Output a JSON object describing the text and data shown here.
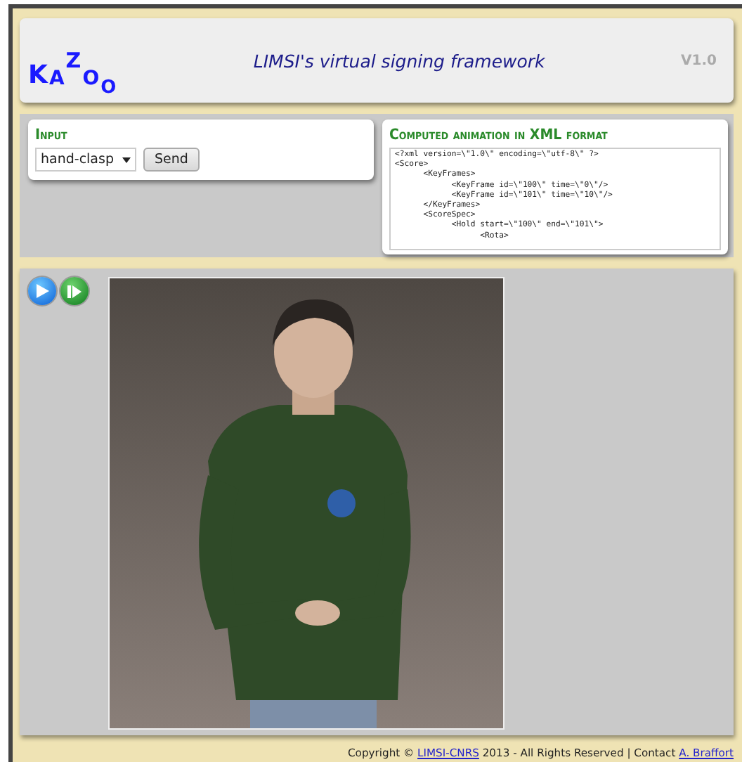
{
  "header": {
    "logo": [
      {
        "letter": "K",
        "kind": "base"
      },
      {
        "letter": "A",
        "kind": "small"
      },
      {
        "letter": "Z",
        "kind": "raised"
      },
      {
        "letter": "O",
        "kind": "small"
      },
      {
        "letter": "O",
        "kind": "lowered"
      }
    ],
    "title": "LIMSI's virtual signing framework",
    "version": "V1.0"
  },
  "input_panel": {
    "title": "Input",
    "select_value": "hand-clasp",
    "button": "Send"
  },
  "xml_panel": {
    "title": "Computed animation in XML format",
    "content": "<?xml version=\\\"1.0\\\" encoding=\\\"utf-8\\\" ?>\n<Score>\n\t<KeyFrames>\n\t\t<KeyFrame id=\\\"100\\\" time=\\\"0\\\"/>\n\t\t<KeyFrame id=\\\"101\\\" time=\\\"10\\\"/>\n\t</KeyFrames>\n\t<ScoreSpec>\n\t\t<Hold start=\\\"100\\\" end=\\\"101\\\">\n\t\t\t<Rota>"
  },
  "player": {
    "controls": [
      {
        "kind": "play"
      },
      {
        "kind": "step"
      }
    ]
  },
  "footer": {
    "parts": [
      {
        "kind": "text",
        "text": "Copyright © "
      },
      {
        "kind": "link",
        "text": "LIMSI-CNRS"
      },
      {
        "kind": "text",
        "text": " 2013 - All Rights Reserved | Contact "
      },
      {
        "kind": "link",
        "text": "A. Braffort"
      }
    ]
  }
}
